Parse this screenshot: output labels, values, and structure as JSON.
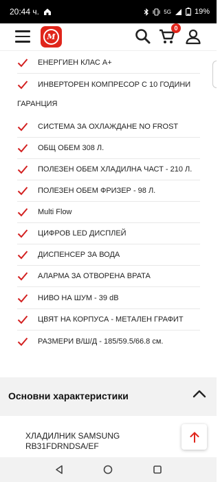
{
  "status_bar": {
    "time": "20:44 ч.",
    "network": "5G",
    "battery": "19%"
  },
  "header": {
    "logo_text": "M",
    "cart_count": "0"
  },
  "features": [
    "ЕНЕРГИЕН КЛАС А+",
    "ИНВЕРТОРЕН КОМПРЕСОР С 10 ГОДИНИ",
    "СИСТЕМА ЗА ОХЛАЖДАНЕ NO FROST",
    "ОБЩ ОБЕМ 308 Л.",
    "ПОЛЕЗЕН ОБЕМ ХЛАДИЛНА ЧАСТ - 210 Л.",
    "ПОЛЕЗЕН ОБЕМ ФРИЗЕР - 98 Л.",
    "Multi Flow",
    "ЦИФРОВ LED ДИСПЛЕЙ",
    "ДИСПЕНСЕР ЗА ВОДА",
    "АЛАРМА ЗА ОТВОРЕНА ВРАТА",
    "НИВО НА ШУМ - 39 dB",
    "ЦВЯТ НА КОРПУСА - МЕТАЛЕН ГРАФИТ",
    "РАЗМЕРИ В/Ш/Д - 185/59.5/66.8 см."
  ],
  "feature_wrap": "ГАРАНЦИЯ",
  "section": {
    "title": "Основни характеристики"
  },
  "product": {
    "name": "ХЛАДИЛНИК SAMSUNG RB31FDRNDSA/EF"
  },
  "colors": {
    "accent": "#e0251b",
    "check": "#d32020"
  },
  "icons": {
    "menu": "hamburger-icon",
    "search": "search-icon",
    "cart": "cart-icon",
    "user": "user-icon",
    "check": "check-icon",
    "chevron": "chevron-up-icon",
    "scroll_top": "arrow-up-icon"
  }
}
